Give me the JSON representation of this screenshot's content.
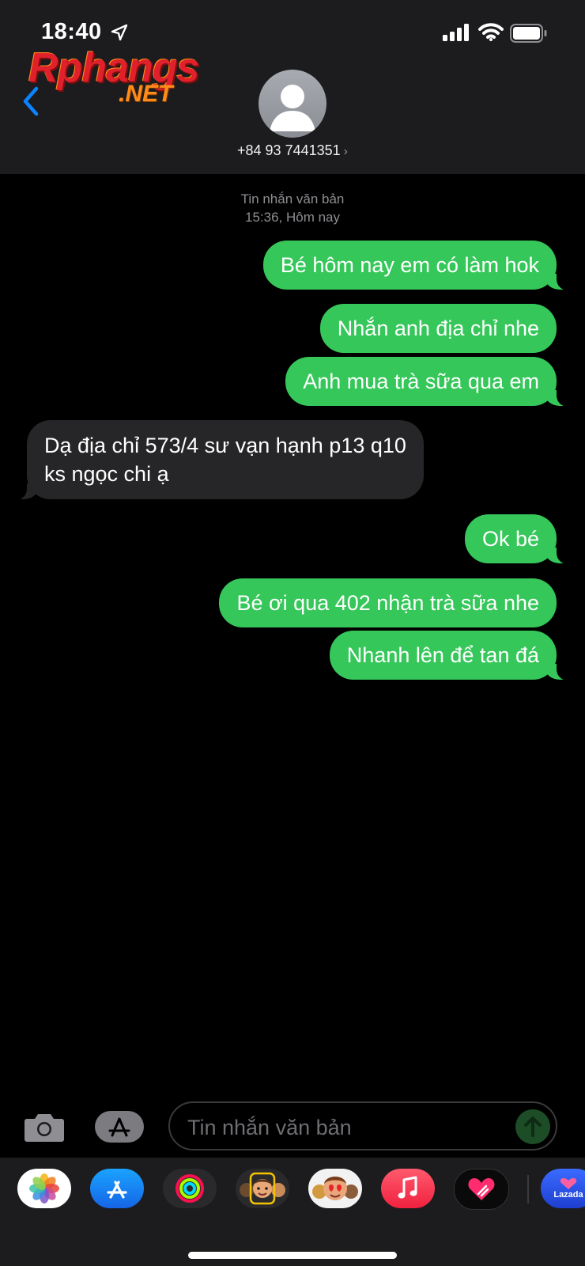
{
  "status_bar": {
    "time": "18:40"
  },
  "watermark": {
    "main": "Rphangs",
    "sub": ".NET"
  },
  "contact": {
    "name": "+84 93 7441351",
    "chevron": "›"
  },
  "thread_meta": {
    "type": "Tin nhắn văn bản",
    "time": "15:36, Hôm nay"
  },
  "messages": [
    {
      "dir": "sent",
      "text": "Bé hôm nay em có làm hok"
    },
    {
      "dir": "sent",
      "text": "Nhắn anh địa chỉ nhe"
    },
    {
      "dir": "sent",
      "text": "Anh mua trà sữa qua em"
    },
    {
      "dir": "received",
      "line1": "Dạ địa chỉ 573/4 sư vạn hạnh p13 q10",
      "line2": "ks ngọc chi ạ"
    },
    {
      "dir": "sent",
      "text": "Ok bé"
    },
    {
      "dir": "sent",
      "text": "Bé ơi qua 402 nhận trà sữa nhe"
    },
    {
      "dir": "sent",
      "text": "Nhanh lên để tan đá"
    }
  ],
  "composer": {
    "placeholder": "Tin nhắn văn bản"
  },
  "app_drawer": [
    {
      "icon": "photos-icon"
    },
    {
      "icon": "app-store-icon"
    },
    {
      "icon": "fitness-icon"
    },
    {
      "icon": "memoji-icon"
    },
    {
      "icon": "animoji-icon"
    },
    {
      "icon": "music-icon"
    },
    {
      "icon": "digital-touch-icon"
    },
    {
      "icon": "lazada-icon",
      "label": "Lazada"
    }
  ],
  "colors": {
    "sent_bubble": "#35c759",
    "received_bubble": "#262628",
    "accent": "#0a84ff"
  }
}
